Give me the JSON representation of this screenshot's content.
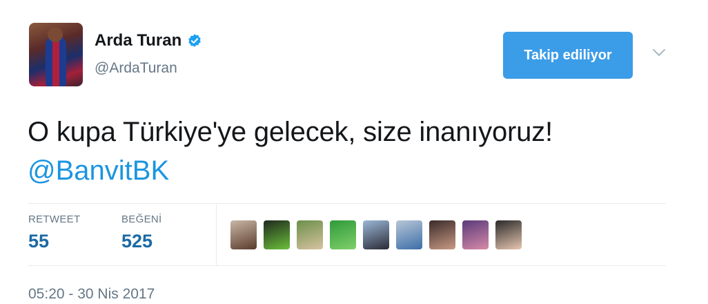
{
  "user": {
    "name": "Arda Turan",
    "handle": "@ArdaTuran",
    "verified_icon": "verified-badge-icon"
  },
  "follow_button": {
    "label": "Takip ediliyor"
  },
  "menu": {
    "icon": "chevron-down-icon"
  },
  "tweet": {
    "text": "O kupa Türkiye'ye gelecek, size inanıyoruz!",
    "mention": "@BanvitBK"
  },
  "stats": {
    "retweet_label": "RETWEET",
    "retweet_count": "55",
    "like_label": "BEĞENİ",
    "like_count": "525"
  },
  "likers": [
    {
      "name": "liker-avatar",
      "color_a": "#c9b7a6",
      "color_b": "#5a3b2c"
    },
    {
      "name": "liker-avatar",
      "color_a": "#1f2a1f",
      "color_b": "#6bbf3a"
    },
    {
      "name": "liker-avatar",
      "color_a": "#6b8f4a",
      "color_b": "#d7c3a0"
    },
    {
      "name": "liker-avatar",
      "color_a": "#2f9a3a",
      "color_b": "#7fd06a"
    },
    {
      "name": "liker-avatar",
      "color_a": "#9bb8d8",
      "color_b": "#2a2a35"
    },
    {
      "name": "liker-avatar",
      "color_a": "#b8c6d6",
      "color_b": "#3c6ea8"
    },
    {
      "name": "liker-avatar",
      "color_a": "#3a2a2a",
      "color_b": "#c99a84"
    },
    {
      "name": "liker-avatar",
      "color_a": "#5a3a7a",
      "color_b": "#d88aa8"
    },
    {
      "name": "liker-avatar",
      "color_a": "#2a2a2a",
      "color_b": "#e8c6b0"
    }
  ],
  "timestamp": "05:20 - 30 Nis 2017",
  "colors": {
    "accent": "#1b95e0",
    "button": "#3b9ce8",
    "count": "#1b6aa5",
    "muted": "#657786"
  }
}
